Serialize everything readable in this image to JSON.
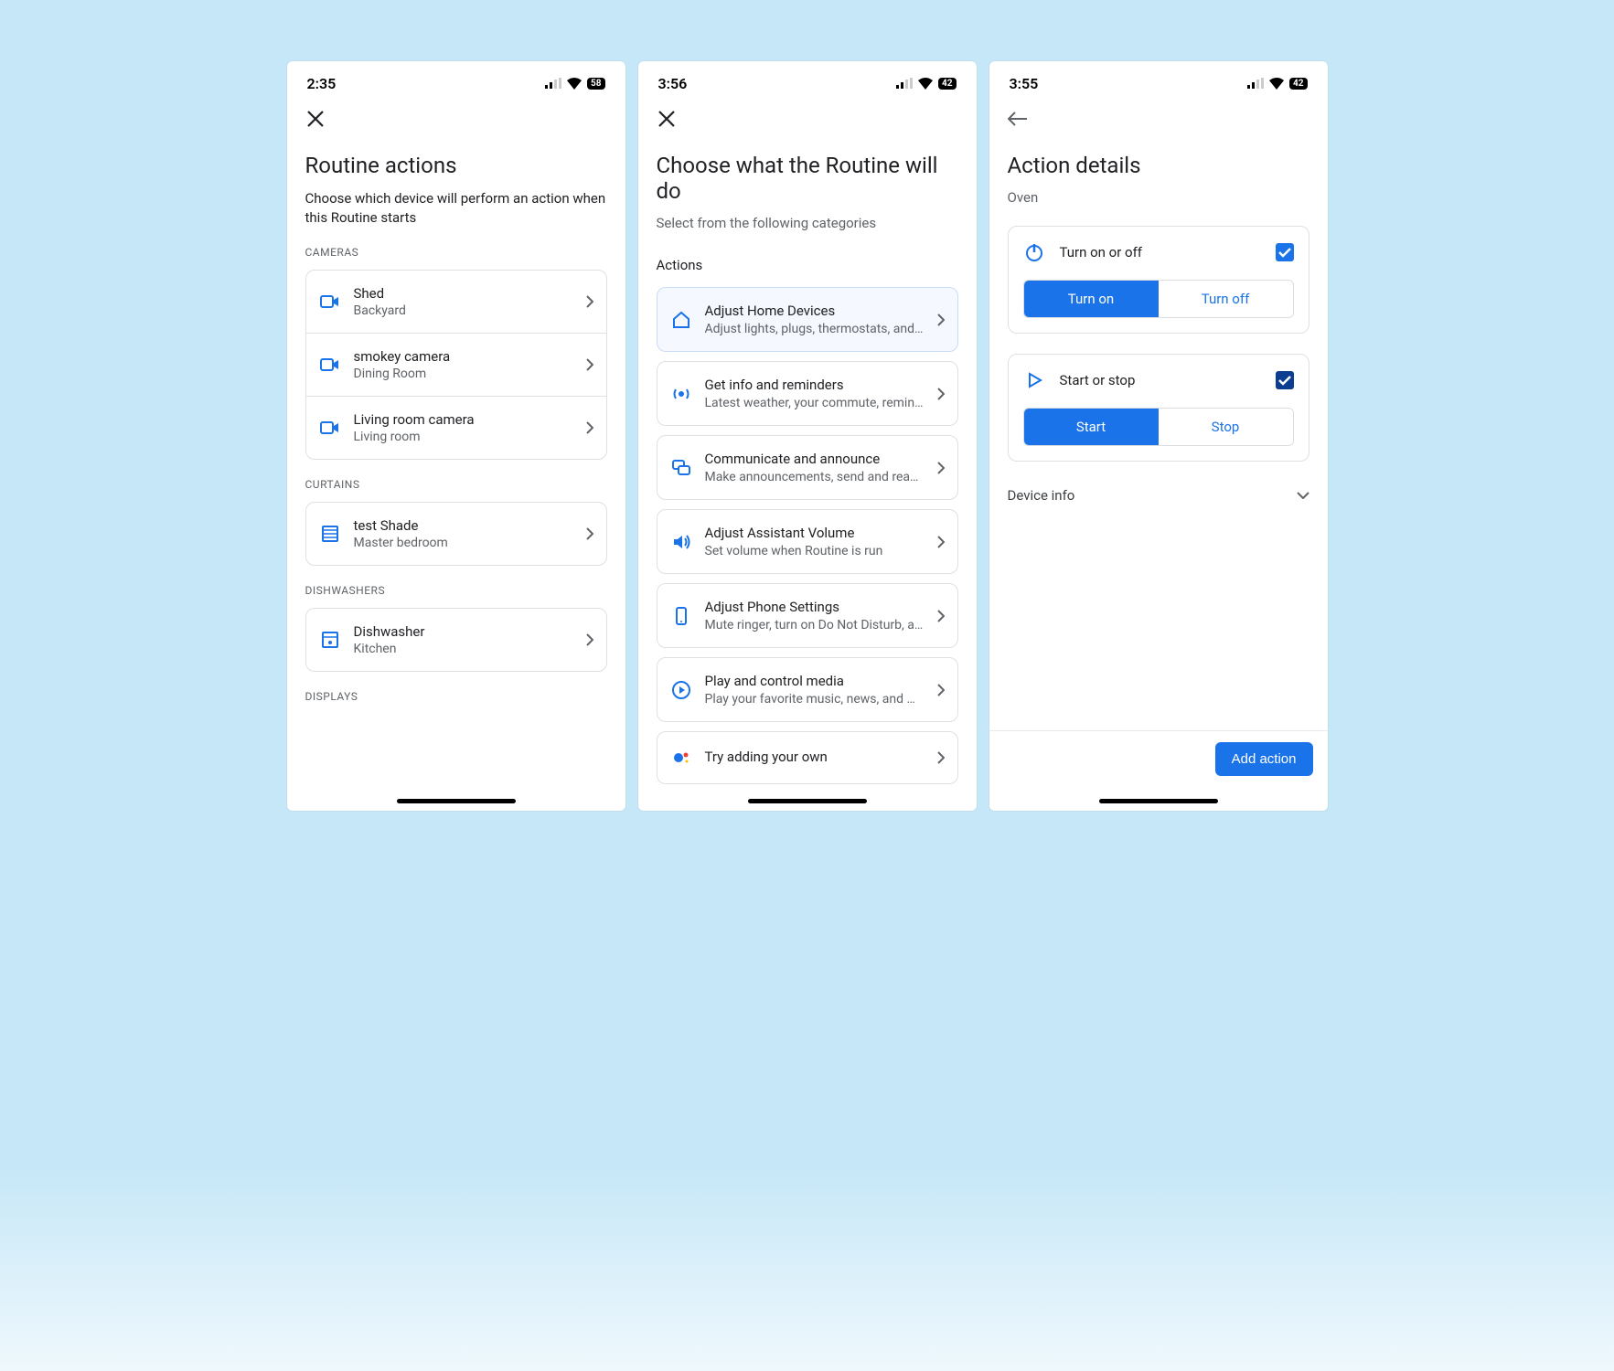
{
  "screen1": {
    "time": "2:35",
    "battery": "58",
    "title": "Routine actions",
    "subtitle": "Choose which device will perform an action when this Routine starts",
    "sections": {
      "cameras": {
        "label": "CAMERAS",
        "items": [
          {
            "title": "Shed",
            "sub": "Backyard"
          },
          {
            "title": "smokey camera",
            "sub": "Dining Room"
          },
          {
            "title": "Living room camera",
            "sub": "Living room"
          }
        ]
      },
      "curtains": {
        "label": "CURTAINS",
        "items": [
          {
            "title": "test Shade",
            "sub": "Master bedroom"
          }
        ]
      },
      "dishwashers": {
        "label": "DISHWASHERS",
        "items": [
          {
            "title": "Dishwasher",
            "sub": "Kitchen"
          }
        ]
      },
      "displays": {
        "label": "DISPLAYS"
      }
    }
  },
  "screen2": {
    "time": "3:56",
    "battery": "42",
    "title": "Choose what the Routine will do",
    "subtitle": "Select from the following categories",
    "section_label": "Actions",
    "actions": [
      {
        "title": "Adjust Home Devices",
        "sub": "Adjust lights, plugs, thermostats, and …"
      },
      {
        "title": "Get info and reminders",
        "sub": "Latest weather, your commute, remind…"
      },
      {
        "title": "Communicate and announce",
        "sub": "Make announcements, send and read t…"
      },
      {
        "title": "Adjust Assistant Volume",
        "sub": "Set volume when Routine is run"
      },
      {
        "title": "Adjust Phone Settings",
        "sub": "Mute ringer, turn on Do Not Disturb, an…"
      },
      {
        "title": "Play and control media",
        "sub": "Play your favorite music, news, and mo…"
      },
      {
        "title": "Try adding your own",
        "sub": ""
      }
    ]
  },
  "screen3": {
    "time": "3:55",
    "battery": "42",
    "title": "Action details",
    "device": "Oven",
    "card1": {
      "label": "Turn on or off",
      "opt1": "Turn on",
      "opt2": "Turn off"
    },
    "card2": {
      "label": "Start or stop",
      "opt1": "Start",
      "opt2": "Stop"
    },
    "expand": "Device info",
    "button": "Add action"
  }
}
